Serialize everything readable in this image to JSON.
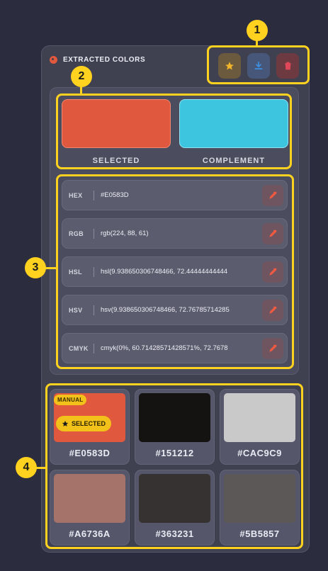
{
  "panel": {
    "title": "EXTRACTED COLORS"
  },
  "toolbar": {
    "star_icon": "star-icon",
    "download_icon": "download-icon",
    "delete_icon": "trash-icon"
  },
  "preview": {
    "selected": {
      "caption": "SELECTED",
      "color": "#E0583D"
    },
    "complement": {
      "caption": "COMPLEMENT",
      "color": "#3DC5E0"
    }
  },
  "formats": [
    {
      "label": "HEX",
      "value": "#E0583D"
    },
    {
      "label": "RGB",
      "value": "rgb(224, 88, 61)"
    },
    {
      "label": "HSL",
      "value": "hsl(9.938650306748466, 72.44444444444"
    },
    {
      "label": "HSV",
      "value": "hsv(9.938650306748466, 72.76785714285"
    },
    {
      "label": "CMYK",
      "value": "cmyk(0%, 60.71428571428571%, 72.7678"
    }
  ],
  "palette": [
    {
      "hex": "#E0583D",
      "manual_badge": "MANUAL",
      "selected_badge": "SELECTED"
    },
    {
      "hex": "#151212"
    },
    {
      "hex": "#CAC9C9"
    },
    {
      "hex": "#A6736A"
    },
    {
      "hex": "#363231"
    },
    {
      "hex": "#5B5857"
    }
  ],
  "callouts": [
    "1",
    "2",
    "3",
    "4"
  ],
  "colors": {
    "accent": "#FFD21F",
    "panel_bg": "#3F4050",
    "page_bg": "#2B2C3D"
  }
}
